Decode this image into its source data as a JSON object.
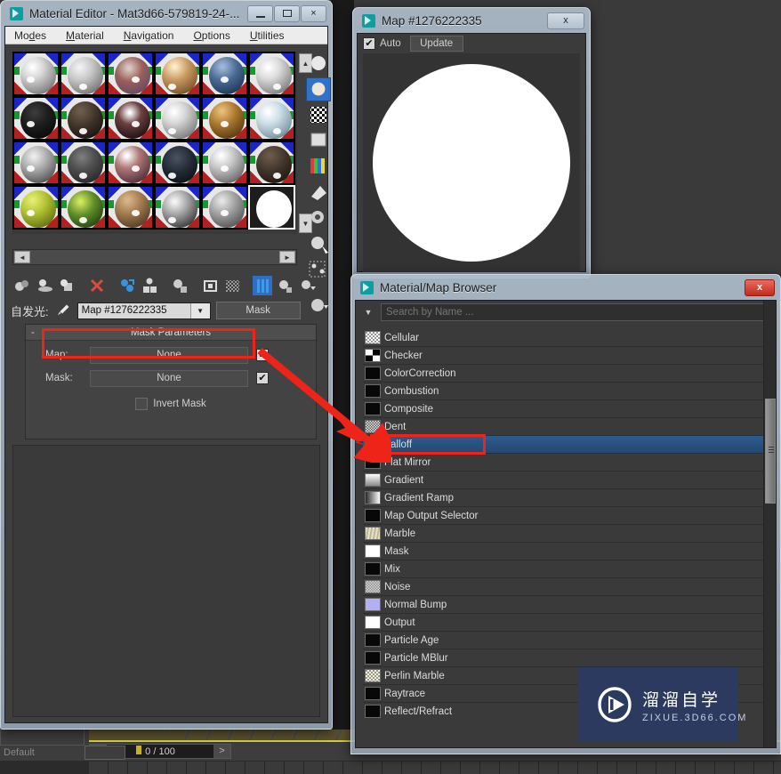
{
  "app": {
    "background_app": "3ds Max viewport",
    "timeline": {
      "frame_label": "0 / 100",
      "prev": "<",
      "next": ">"
    },
    "status_default": "Default"
  },
  "material_editor": {
    "title": "Material Editor - Mat3d66-579819-24-...",
    "icon": "max-app-icon",
    "window_buttons": {
      "minimize": "minimize-button",
      "maximize": "maximize-button",
      "close": "×"
    },
    "menu": [
      {
        "label": "Modes",
        "mnemonic": "d"
      },
      {
        "label": "Material",
        "mnemonic": "M"
      },
      {
        "label": "Navigation",
        "mnemonic": "N"
      },
      {
        "label": "Options",
        "mnemonic": "O"
      },
      {
        "label": "Utilities",
        "mnemonic": "U"
      }
    ],
    "slots": [
      {
        "name": "slot-1",
        "ball": "radial-gradient(circle at 34% 28%, #ffffff 2%, #d8d8d8 30%, #8e8e8e 70%, #4a4a4a 100%)"
      },
      {
        "name": "slot-2",
        "ball": "radial-gradient(circle at 34% 28%, #f2f2f2 2%, #c9c9c9 35%, #868686 72%, #3f3f3f 100%)"
      },
      {
        "name": "slot-3",
        "ball": "radial-gradient(circle at 40% 30%, #d9c7bf 5%, #9a5f5a 40%, #6c4f63 75%, #2d2230 100%)"
      },
      {
        "name": "slot-4",
        "ball": "radial-gradient(circle at 36% 26%, #ffeccd 3%, #c99a61 38%, #8a6336 72%, #3a2a16 100%)"
      },
      {
        "name": "slot-5",
        "ball": "radial-gradient(circle at 38% 26%, #9fb7d4 4%, #4a6b96 40%, #26405f 75%, #101b29 100%)"
      },
      {
        "name": "slot-6",
        "ball": "radial-gradient(circle at 34% 28%, #ffffff 2%, #dcdcdc 32%, #909090 72%, #4d4d4d 100%)"
      },
      {
        "name": "slot-7",
        "ball": "radial-gradient(circle at 40% 30%, #3a3a3a 4%, #1d1d1d 40%, #0b0b0b 80%, #000000 100%)"
      },
      {
        "name": "slot-8",
        "ball": "radial-gradient(circle at 36% 26%, #6d5c4b 4%, #3e3228 45%, #1d1711 80%, #0a0806 100%)"
      },
      {
        "name": "slot-9",
        "ball": "radial-gradient(circle at 42% 30%, #ffffff 3%, #6a4040 35%, #241414 78%, #060606 100%)"
      },
      {
        "name": "slot-10",
        "ball": "radial-gradient(circle at 34% 28%, #ffffff 2%, #d7d7d7 32%, #8d8d8d 72%, #454545 100%)"
      },
      {
        "name": "slot-11",
        "ball": "radial-gradient(circle at 36% 26%, #e8c07a 3%, #a8762c 40%, #5e3f14 78%, #241806 100%)"
      },
      {
        "name": "slot-12",
        "ball": "radial-gradient(circle at 34% 28%, #ffffff 2%, #cfe0e8 32%, #8aa3b0 70%, #3f5058 100%)"
      },
      {
        "name": "slot-13",
        "ball": "radial-gradient(circle at 38% 28%, #ededed 3%, #a8a8a8 40%, #5a5a5a 78%, #1c1c1c 100%)"
      },
      {
        "name": "slot-14",
        "ball": "radial-gradient(circle at 40% 30%, #7a7a7a 4%, #4d4d4d 40%, #2a2a2a 80%, #101010 100%)"
      },
      {
        "name": "slot-15",
        "ball": "radial-gradient(circle at 34% 26%, #ffffff 3%, #b07878 35%, #5d3a44 75%, #1d1318 100%)"
      },
      {
        "name": "slot-16",
        "ball": "radial-gradient(circle at 42% 32%, #45505e 5%, #222a35 45%, #0d1118 82%, #050608 100%)"
      },
      {
        "name": "slot-17",
        "ball": "radial-gradient(circle at 34% 26%, #ffffff 2%, #c9c9c9 34%, #7c7c7c 72%, #333333 100%)"
      },
      {
        "name": "slot-18",
        "ball": "radial-gradient(circle at 38% 26%, #6b5a4a 4%, #40342a 45%, #221a13 80%, #0c0906 100%)"
      },
      {
        "name": "slot-19",
        "ball": "radial-gradient(circle at 34% 26%, #e4ef72 3%, #b2c232 38%, #6f7c18 76%, #2b3008 100%)"
      },
      {
        "name": "slot-20",
        "ball": "radial-gradient(circle at 36% 30%, #d6e85f 3%, #5f8e2a 40%, #2b4a12 78%, #0e1a06 100%)"
      },
      {
        "name": "slot-21",
        "ball": "radial-gradient(circle at 36% 26%, #d8b48a 4%, #a07a4e 40%, #5c4228 78%, #231807 100%)"
      },
      {
        "name": "slot-22",
        "ball": "radial-gradient(circle at 36% 30%, #f4f4f4 4%, #9a9a9a 42%, #3c3c3c 80%, #0a0a0a 100%)"
      },
      {
        "name": "slot-23",
        "ball": "radial-gradient(circle at 36% 28%, #e6e6e6 3%, #9e9e9e 40%, #5c5c5c 78%, #232323 100%)"
      },
      {
        "name": "slot-24",
        "ball": "radial-gradient(circle at 50% 50%, #ffffff 0%, #ffffff 96%, #f0f0f0 100%)",
        "active": true
      }
    ],
    "slot_scroll": {
      "up": "▲",
      "down": "▼",
      "left": "◄",
      "right": "►"
    },
    "vertical_tools": [
      "sample-type-sphere-icon",
      "backlight-icon",
      "background-checker-icon",
      "sample-uv-tiling-icon",
      "video-color-check-icon",
      "make-preview-icon",
      "options-icon",
      "select-by-material-icon",
      "material-id-channel-icon",
      "show-end-result-icon"
    ],
    "horizontal_tools": [
      "get-material-icon",
      "put-material-to-scene-icon",
      "assign-material-to-selection-icon",
      "reset-map-icon",
      "make-material-copy-icon",
      "make-unique-icon",
      "put-to-library-icon",
      "material-effects-channel-icon",
      "show-map-in-viewport-icon",
      "show-end-result-icon",
      "go-to-parent-icon",
      "go-forward-to-sibling-icon"
    ],
    "name_row": {
      "channel_label": "自发光:",
      "eyedropper_icon": "eyedropper-icon",
      "map_name": "Map #1276222335",
      "dropdown_icon": "chevron-down-icon",
      "type_button": "Mask"
    },
    "rollout": {
      "collapse_icon": "-",
      "title": "Mask Parameters",
      "rows": [
        {
          "label": "Map:",
          "value": "None",
          "checked": true
        },
        {
          "label": "Mask:",
          "value": "None",
          "checked": true
        }
      ],
      "invert_mask": {
        "label": "Invert Mask",
        "checked": false
      }
    }
  },
  "map_window": {
    "title": "Map #1276222335",
    "icon": "max-app-icon",
    "close_label": "x",
    "auto_label": "Auto",
    "auto_checked": true,
    "update_label": "Update",
    "preview": "white-circle-preview"
  },
  "browser": {
    "title": "Material/Map Browser",
    "icon": "max-app-icon",
    "close_label": "x",
    "search": {
      "placeholder": "Search by Name ...",
      "value": "",
      "dropdown_icon": "chevron-down-icon"
    },
    "items": [
      {
        "label": "Cellular",
        "swatch": "repeating-conic-gradient(#fff 0 25%, #9a9a9a 0 50%) 0 0/4px 4px"
      },
      {
        "label": "Checker",
        "swatch": "conic-gradient(#000 0 25%, #fff 0 50%, #000 0 75%, #fff 0)"
      },
      {
        "label": "ColorCorrection",
        "swatch": "#080808"
      },
      {
        "label": "Combustion",
        "swatch": "#080808"
      },
      {
        "label": "Composite",
        "swatch": "#080808"
      },
      {
        "label": "Dent",
        "swatch": "repeating-conic-gradient(#e8e8e8 0 25%, #5a5a5a 0 50%) 0 0/3px 3px"
      },
      {
        "label": "Falloff",
        "swatch": "linear-gradient(90deg,#9a9a9a,#ffffff)",
        "selected": true
      },
      {
        "label": "Flat Mirror",
        "swatch": "#080808"
      },
      {
        "label": "Gradient",
        "swatch": "linear-gradient(180deg,#ffffff,#8a8a8a)"
      },
      {
        "label": "Gradient Ramp",
        "swatch": "linear-gradient(90deg,#2a2a2a,#ffffff)"
      },
      {
        "label": "Map Output Selector",
        "swatch": "#080808"
      },
      {
        "label": "Marble",
        "swatch": "repeating-linear-gradient(100deg,#e6e2c8 0 2px,#bdb894 2px 4px)"
      },
      {
        "label": "Mask",
        "swatch": "#ffffff"
      },
      {
        "label": "Mix",
        "swatch": "#080808"
      },
      {
        "label": "Noise",
        "swatch": "repeating-conic-gradient(#d8d8d8 0 25%, #8e8e8e 0 50%) 0 0/3px 3px"
      },
      {
        "label": "Normal Bump",
        "swatch": "#b3b0f2"
      },
      {
        "label": "Output",
        "swatch": "#ffffff"
      },
      {
        "label": "Particle Age",
        "swatch": "#080808"
      },
      {
        "label": "Particle MBlur",
        "swatch": "#080808"
      },
      {
        "label": "Perlin Marble",
        "swatch": "repeating-conic-gradient(#efeee0 0 25%, #9c9a86 0 50%) 0 0/4px 4px"
      },
      {
        "label": "Raytrace",
        "swatch": "#080808"
      },
      {
        "label": "Reflect/Refract",
        "swatch": "#080808"
      }
    ],
    "scrollbar": "vertical-scrollbar"
  },
  "annotations": {
    "map_row_highlight": "red-rectangle-map-row",
    "falloff_highlight": "red-rectangle-falloff",
    "arrow": "red-arrow-pointing-from-map-row-to-falloff"
  },
  "watermark": {
    "chinese": "溜溜自学",
    "english": "ZIXUE.3D66.COM",
    "logo": "play-button-logo",
    "bg_color": "#2b3a5e"
  },
  "colors": {
    "accent_blue": "#2f6fc2",
    "selection_blue": "#2e5b8f",
    "annotation_red": "#ef2418",
    "panel_gray": "#3f3f3f"
  }
}
